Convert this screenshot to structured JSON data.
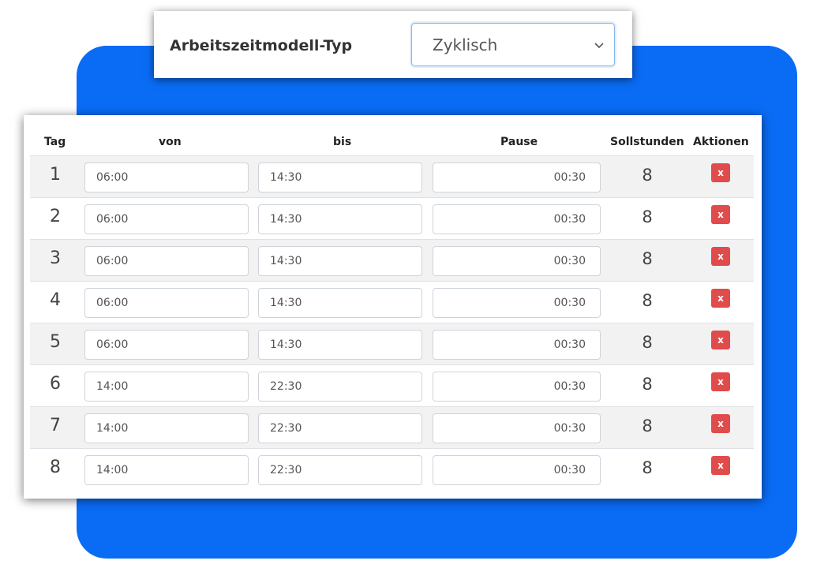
{
  "type_panel": {
    "label": "Arbeitszeitmodell-Typ",
    "selected_value": "Zyklisch"
  },
  "table": {
    "headers": {
      "tag": "Tag",
      "von": "von",
      "bis": "bis",
      "pause": "Pause",
      "soll": "Sollstunden",
      "aktionen": "Aktionen"
    },
    "delete_label": "x",
    "rows": [
      {
        "tag": "1",
        "von": "06:00",
        "bis": "14:30",
        "pause": "00:30",
        "soll": "8"
      },
      {
        "tag": "2",
        "von": "06:00",
        "bis": "14:30",
        "pause": "00:30",
        "soll": "8"
      },
      {
        "tag": "3",
        "von": "06:00",
        "bis": "14:30",
        "pause": "00:30",
        "soll": "8"
      },
      {
        "tag": "4",
        "von": "06:00",
        "bis": "14:30",
        "pause": "00:30",
        "soll": "8"
      },
      {
        "tag": "5",
        "von": "06:00",
        "bis": "14:30",
        "pause": "00:30",
        "soll": "8"
      },
      {
        "tag": "6",
        "von": "14:00",
        "bis": "22:30",
        "pause": "00:30",
        "soll": "8"
      },
      {
        "tag": "7",
        "von": "14:00",
        "bis": "22:30",
        "pause": "00:30",
        "soll": "8"
      },
      {
        "tag": "8",
        "von": "14:00",
        "bis": "22:30",
        "pause": "00:30",
        "soll": "8"
      }
    ]
  },
  "colors": {
    "accent_blue": "#0a6cf5",
    "delete_red": "#e04b4b",
    "stripe": "#f2f2f2"
  }
}
